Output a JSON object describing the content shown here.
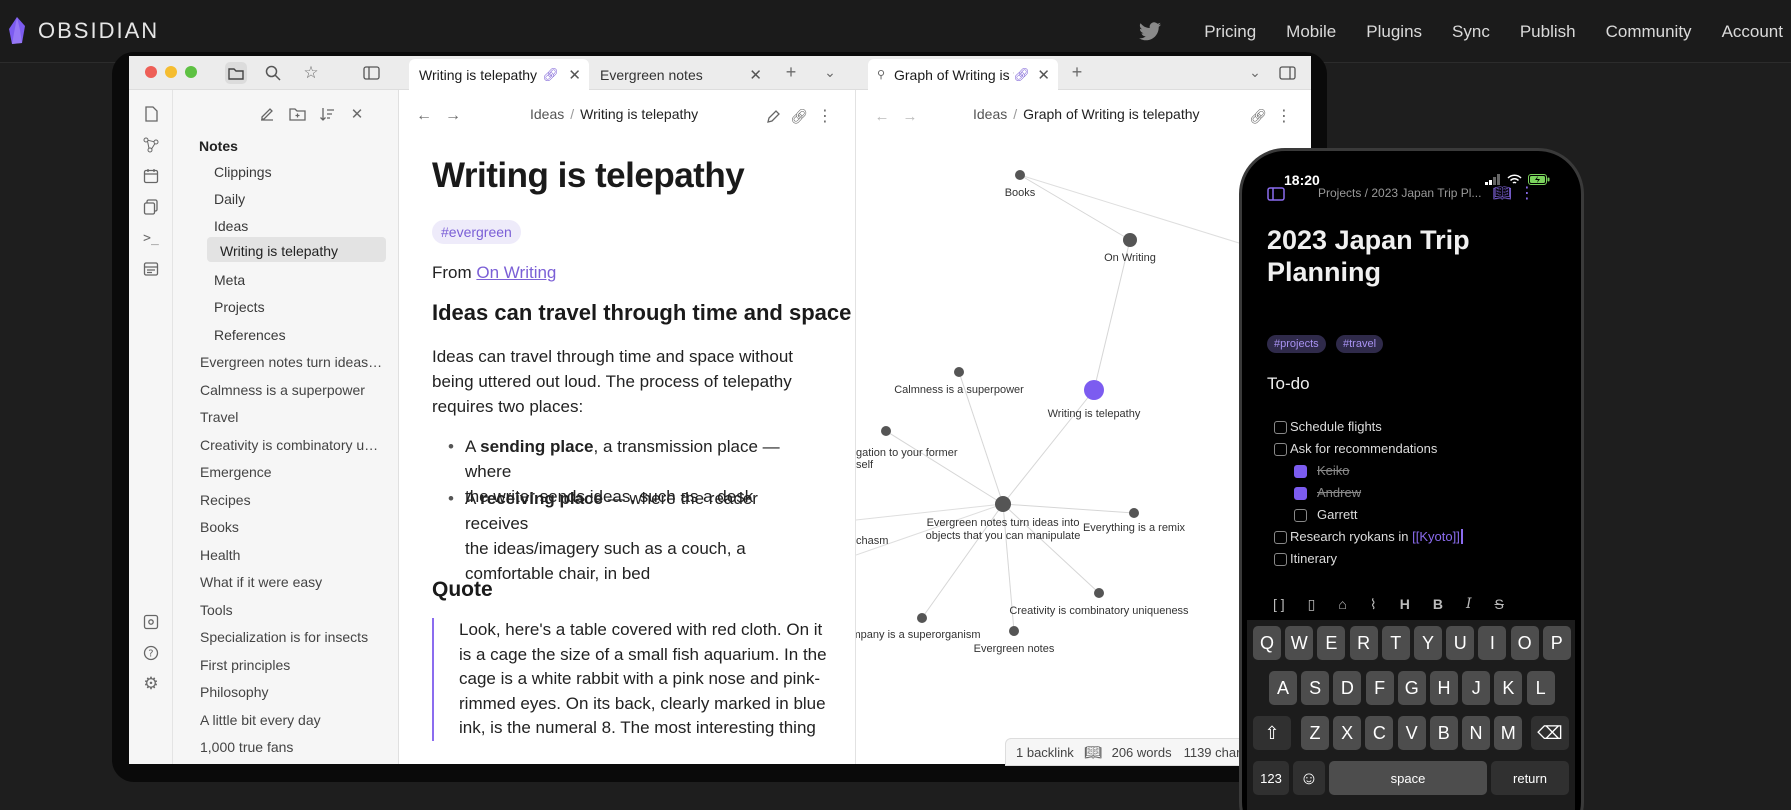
{
  "site": {
    "logo_text": "OBSIDIAN",
    "nav": [
      "Pricing",
      "Mobile",
      "Plugins",
      "Sync",
      "Publish",
      "Community",
      "Account"
    ]
  },
  "desktop": {
    "tabs": [
      {
        "label": "Writing is telepathy"
      },
      {
        "label": "Evergreen notes"
      },
      {
        "label": "Graph of Writing is telepathy"
      }
    ],
    "sidebar": {
      "title": "Notes",
      "folders": [
        "Clippings",
        "Daily",
        "Ideas",
        "Meta",
        "Projects",
        "References"
      ],
      "active_file": "Writing is telepathy",
      "files": [
        "Evergreen notes turn ideas…",
        "Calmness is a superpower",
        "Travel",
        "Creativity is combinatory u…",
        "Emergence",
        "Recipes",
        "Books",
        "Health",
        "What if it were easy",
        "Tools",
        "Specialization is for insects",
        "First principles",
        "Philosophy",
        "A little bit every day",
        "1,000 true fans"
      ]
    },
    "editor": {
      "breadcrumb": [
        "Ideas",
        "Writing is telepathy"
      ],
      "title": "Writing is telepathy",
      "tag": "#evergreen",
      "from_prefix": "From ",
      "from_link": "On Writing",
      "h2_a": "Ideas can travel through time and space",
      "para": [
        "Ideas can travel through time and space without",
        "being uttered out loud. The process of telepathy",
        "requires two places:"
      ],
      "bullets": [
        {
          "pre": "A ",
          "bold": "sending place",
          "post": ", a transmission place — where",
          "line2": "the writer sends ideas, such as a desk"
        },
        {
          "pre": "A ",
          "bold": "receiving place",
          "post": " — where the reader receives",
          "line2": "the ideas/imagery such as a couch, a",
          "line3": "comfortable chair, in bed"
        }
      ],
      "h2_b": "Quote",
      "quote": "Look, here's a table covered with red cloth. On it is a cage the size of a small fish aquarium. In the cage is a white rabbit with a pink nose and pink-rimmed eyes. On its back, clearly marked in blue ink, is the numeral 8. The most interesting thing"
    },
    "graph": {
      "breadcrumb": [
        "Ideas",
        "Graph of Writing is telepathy"
      ],
      "nodes": [
        {
          "label": "Books"
        },
        {
          "label": "On Writing"
        },
        {
          "label": "Calmness is a superpower"
        },
        {
          "label": "Writing is telepathy"
        },
        {
          "label": "gation to your former"
        },
        {
          "label": "self"
        },
        {
          "label": "Evergreen notes turn ideas into"
        },
        {
          "label": "objects that you can manipulate"
        },
        {
          "label": "Everything is a remix"
        },
        {
          "label": "chasm"
        },
        {
          "label": "mpany is a superorganism"
        },
        {
          "label": "Creativity is combinatory uniqueness"
        },
        {
          "label": "Evergreen notes"
        }
      ]
    },
    "status": {
      "backlinks": "1 backlink",
      "words": "206 words",
      "chars": "1139 char"
    }
  },
  "phone": {
    "time": "18:20",
    "breadcrumb": "Projects / 2023 Japan Trip Pl...",
    "title_l1": "2023 Japan Trip",
    "title_l2": "Planning",
    "tags": [
      "#projects",
      "#travel"
    ],
    "heading": "To-do",
    "todos": [
      "Schedule flights",
      "Ask for recommendations",
      "Keiko",
      "Andrew",
      "Garrett",
      "Research ryokans in ",
      "Itinerary"
    ],
    "link": "[[Kyoto]]",
    "keys": {
      "row1": [
        "Q",
        "W",
        "E",
        "R",
        "T",
        "Y",
        "U",
        "I",
        "O",
        "P"
      ],
      "row2": [
        "A",
        "S",
        "D",
        "F",
        "G",
        "H",
        "J",
        "K",
        "L"
      ],
      "row3": [
        "Z",
        "X",
        "C",
        "V",
        "B",
        "N",
        "M"
      ],
      "num": "123",
      "space": "space",
      "return": "return"
    }
  },
  "colors": {
    "accent": "#7c5cf0",
    "link": "#7b5fd6"
  }
}
